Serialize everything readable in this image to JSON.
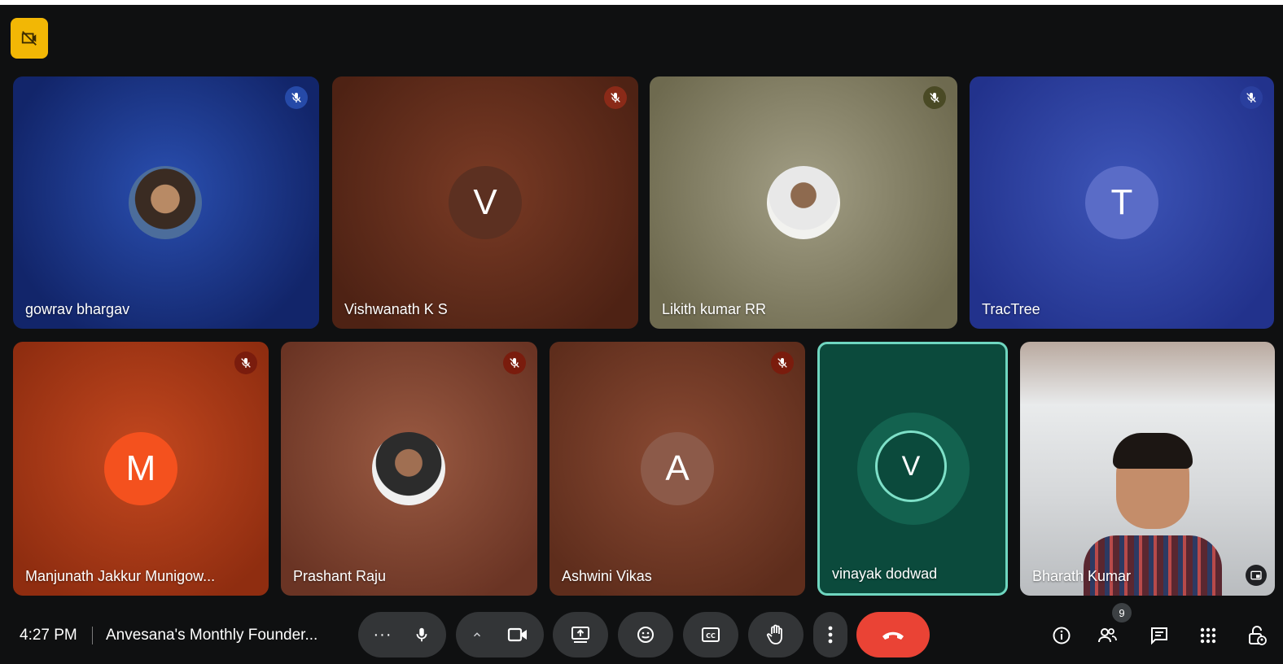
{
  "meeting": {
    "time": "4:27 PM",
    "title": "Anvesana's Monthly Founder...",
    "participants_badge": "9"
  },
  "participants": [
    {
      "name": "gowrav bhargav",
      "initial": "",
      "muted": true,
      "bg": "#1f3a8f",
      "type": "photo"
    },
    {
      "name": "Vishwanath K S",
      "initial": "V",
      "muted": true,
      "bg": "#6a3321",
      "type": "initial"
    },
    {
      "name": "Likith kumar RR",
      "initial": "",
      "muted": true,
      "bg": "#8f8a6d",
      "type": "photo"
    },
    {
      "name": "TracTree",
      "initial": "T",
      "muted": true,
      "bg": "#3045a0",
      "type": "initial"
    },
    {
      "name": "Manjunath Jakkur Munigow...",
      "initial": "M",
      "muted": true,
      "bg": "#b5401d",
      "type": "initial"
    },
    {
      "name": "Prashant Raju",
      "initial": "",
      "muted": true,
      "bg": "#7a4433",
      "type": "photo"
    },
    {
      "name": "Ashwini Vikas",
      "initial": "A",
      "muted": true,
      "bg": "#6b3525",
      "type": "initial"
    },
    {
      "name": "vinayak dodwad",
      "initial": "V",
      "muted": false,
      "bg": "#0b4a3c",
      "type": "speaking"
    },
    {
      "name": "Bharath Kumar",
      "initial": "",
      "muted": false,
      "bg": "#cfd2d4",
      "type": "video"
    }
  ],
  "icons": {
    "badge": "no-video-icon",
    "mute": "mic-off-icon",
    "controls": [
      "more-dots-icon",
      "mic-icon",
      "chevron-up-icon",
      "camera-icon",
      "present-icon",
      "emoji-icon",
      "captions-icon",
      "raise-hand-icon",
      "more-vert-icon",
      "end-call-icon"
    ],
    "right": [
      "info-icon",
      "people-icon",
      "chat-icon",
      "activities-icon",
      "host-controls-icon"
    ]
  },
  "colors": {
    "accent": "#f2b705",
    "end_call": "#ea4335",
    "speaking_border": "#6fd6c0"
  }
}
